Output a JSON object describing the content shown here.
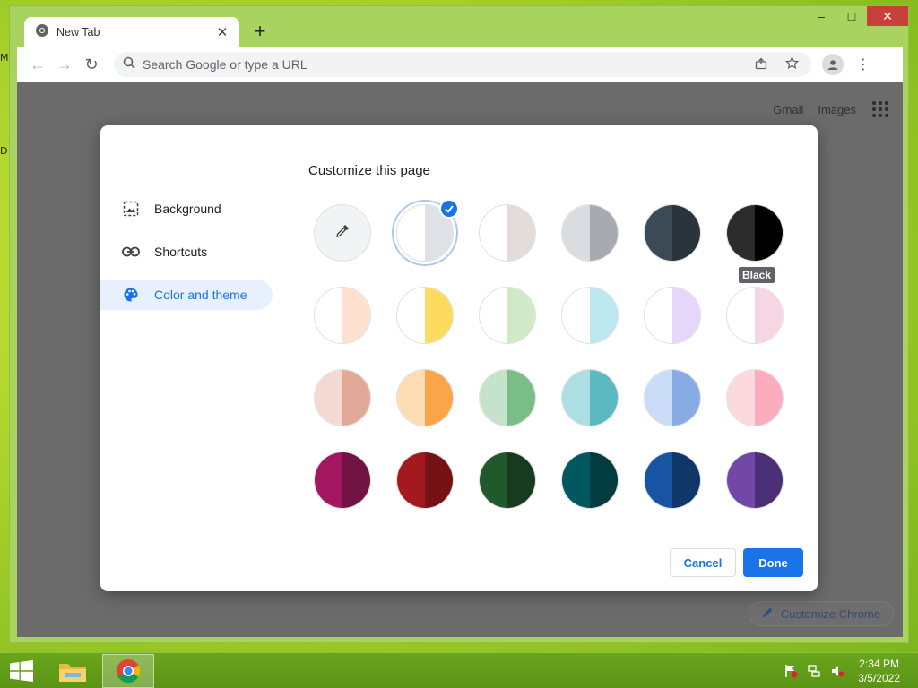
{
  "desktop": {
    "icon_label_1": "M",
    "icon_label_2": "D"
  },
  "browser": {
    "tab_title": "New Tab",
    "tab_close": "✕",
    "new_tab": "+",
    "window_controls": {
      "minimize": "–",
      "maximize": "□",
      "close": "✕"
    },
    "nav": {
      "back": "←",
      "forward": "→",
      "reload": "↻"
    },
    "omnibox_placeholder": "Search Google or type a URL",
    "menu": "⋮"
  },
  "newtab": {
    "links": [
      "Gmail",
      "Images"
    ],
    "customize_chrome": "Customize Chrome"
  },
  "dialog": {
    "title": "Customize this page",
    "sidebar": [
      {
        "label": "Background",
        "icon": "image-icon",
        "active": false
      },
      {
        "label": "Shortcuts",
        "icon": "link-icon",
        "active": false
      },
      {
        "label": "Color and theme",
        "icon": "palette-icon",
        "active": true
      }
    ],
    "selected_index": 1,
    "hovered_index": 5,
    "tooltip": "Black",
    "swatches": [
      {
        "left": "#f1f3f4",
        "right": "#f1f3f4",
        "picker": true
      },
      {
        "left": "#ffffff",
        "right": "#dee1e6"
      },
      {
        "left": "#ffffff",
        "right": "#e3dcd9"
      },
      {
        "left": "#dadce0",
        "right": "#a7aab0"
      },
      {
        "left": "#3c4a55",
        "right": "#2a343b"
      },
      {
        "left": "#2b2b2b",
        "right": "#000000"
      },
      {
        "left": "#ffffff",
        "right": "#fde0cf"
      },
      {
        "left": "#ffffff",
        "right": "#fddb60"
      },
      {
        "left": "#ffffff",
        "right": "#cfe9c9"
      },
      {
        "left": "#ffffff",
        "right": "#bce6f0"
      },
      {
        "left": "#ffffff",
        "right": "#e5d6fa"
      },
      {
        "left": "#ffffff",
        "right": "#f7d6e3"
      },
      {
        "left": "#f3d9d2",
        "right": "#e2a999"
      },
      {
        "left": "#fddcb4",
        "right": "#fba54a"
      },
      {
        "left": "#c5e3cc",
        "right": "#7bbd86"
      },
      {
        "left": "#acdee2",
        "right": "#5ab9c1"
      },
      {
        "left": "#cadcf8",
        "right": "#88abe6"
      },
      {
        "left": "#fcd9df",
        "right": "#fbadbd"
      },
      {
        "left": "#a31760",
        "right": "#711344"
      },
      {
        "left": "#a3191f",
        "right": "#741216"
      },
      {
        "left": "#205a2c",
        "right": "#183a1f"
      },
      {
        "left": "#02585f",
        "right": "#023b40"
      },
      {
        "left": "#1755a2",
        "right": "#0f3768"
      },
      {
        "left": "#7148a8",
        "right": "#4b2f77"
      }
    ],
    "cancel": "Cancel",
    "done": "Done"
  },
  "taskbar": {
    "time": "2:34 PM",
    "date": "3/5/2022"
  },
  "colors": {
    "accent": "#1a73e8",
    "desktop": "#a9d22a"
  }
}
